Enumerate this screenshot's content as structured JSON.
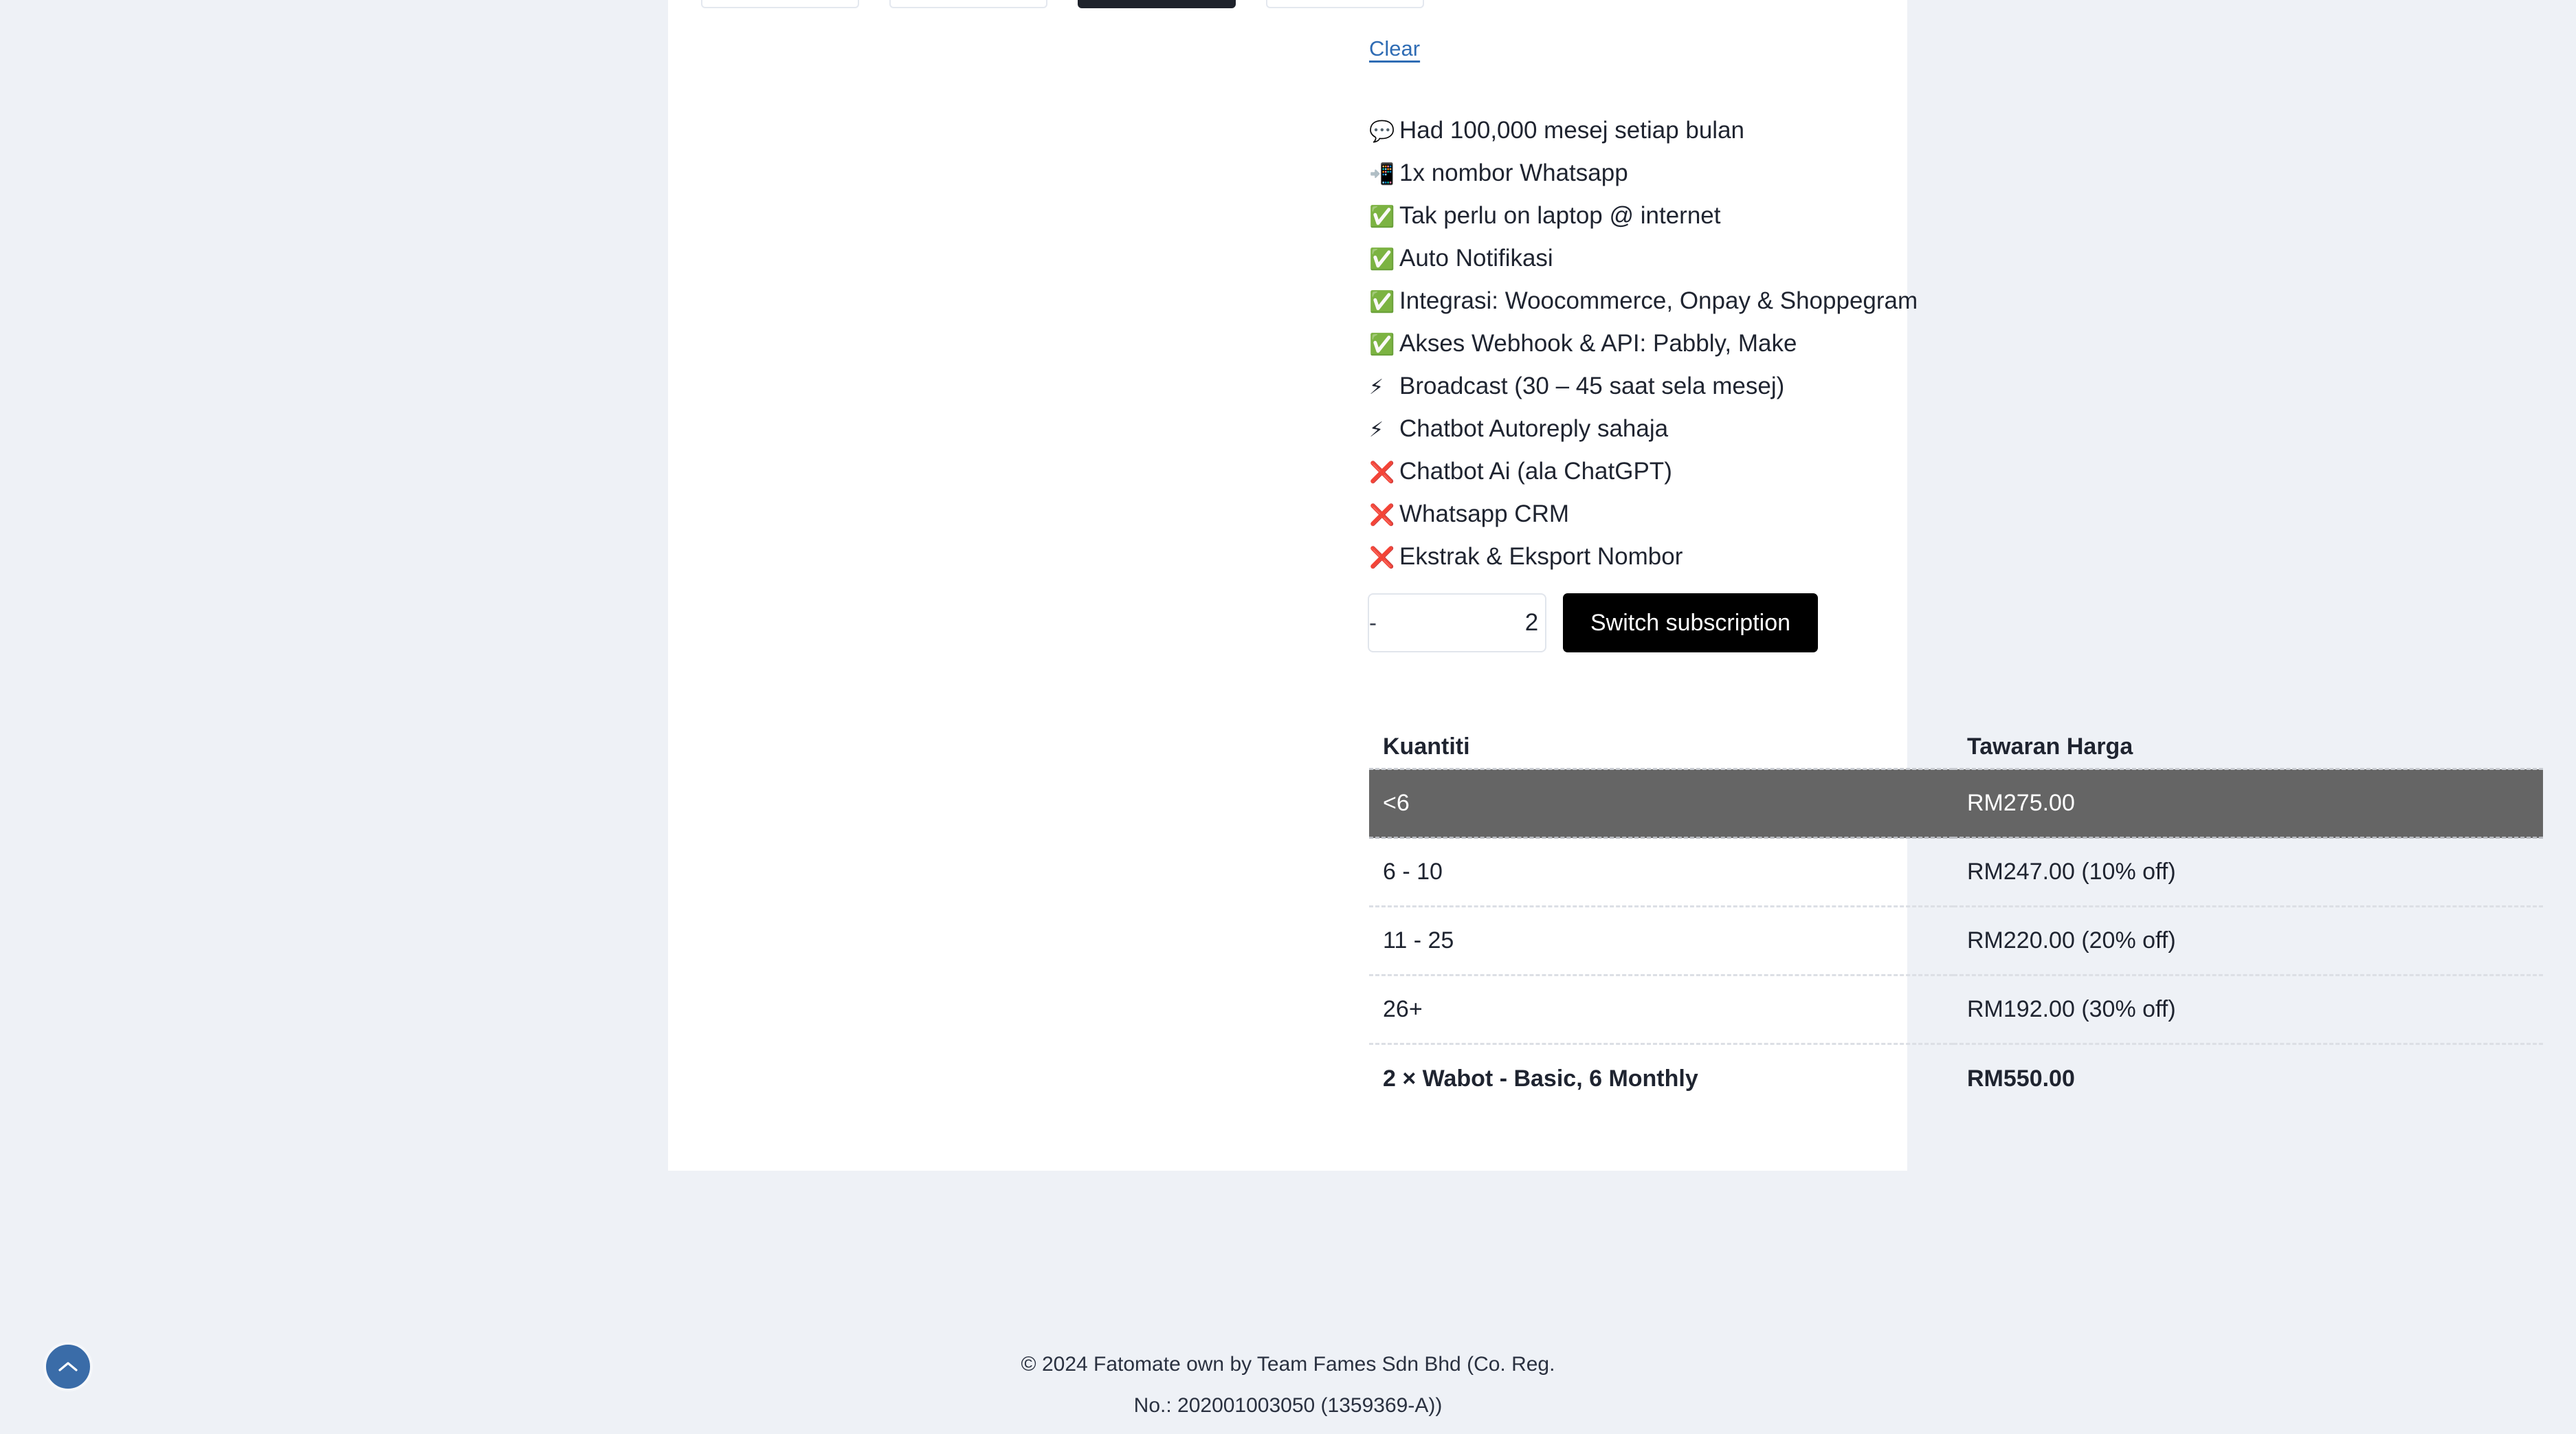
{
  "product": {
    "variations": [
      {
        "label": "",
        "selected": false
      },
      {
        "label": "",
        "selected": false
      },
      {
        "label": "",
        "selected": true
      },
      {
        "label": "",
        "selected": false
      }
    ],
    "clear_label": "Clear",
    "features": [
      {
        "icon": "💬",
        "icon_name": "speech-balloon-icon",
        "text": "Had 100,000 mesej setiap bulan"
      },
      {
        "icon": "📲",
        "icon_name": "mobile-phone-arrow-icon",
        "text": "1x nombor Whatsapp"
      },
      {
        "icon": "✅",
        "icon_name": "check-mark-button-icon",
        "text": "Tak perlu on laptop @ internet"
      },
      {
        "icon": "✅",
        "icon_name": "check-mark-button-icon",
        "text": "Auto Notifikasi"
      },
      {
        "icon": "✅",
        "icon_name": "check-mark-button-icon",
        "text": "Integrasi: Woocommerce, Onpay & Shoppegram"
      },
      {
        "icon": "✅",
        "icon_name": "check-mark-button-icon",
        "text": "Akses Webhook & API: Pabbly, Make"
      },
      {
        "icon": "⚡",
        "icon_name": "high-voltage-icon",
        "text": "Broadcast (30 – 45 saat sela mesej)"
      },
      {
        "icon": "⚡",
        "icon_name": "high-voltage-icon",
        "text": "Chatbot Autoreply sahaja"
      },
      {
        "icon": "❌",
        "icon_name": "cross-mark-icon",
        "text": "Chatbot Ai (ala ChatGPT)"
      },
      {
        "icon": "❌",
        "icon_name": "cross-mark-icon",
        "text": "Whatsapp CRM"
      },
      {
        "icon": "❌",
        "icon_name": "cross-mark-icon",
        "text": "Ekstrak & Eksport Nombor"
      }
    ],
    "quantity": {
      "decrement_label": "-",
      "value": "2",
      "increment_label": "+"
    },
    "switch_subscription_label": "Switch subscription"
  },
  "pricing_table": {
    "headers": [
      "Kuantiti",
      "Tawaran Harga"
    ],
    "rows": [
      {
        "quantity": "<6",
        "price": "RM275.00",
        "active": true
      },
      {
        "quantity": "6 - 10",
        "price": "RM247.00 (10% off)",
        "active": false
      },
      {
        "quantity": "11 - 25",
        "price": "RM220.00 (20% off)",
        "active": false
      },
      {
        "quantity": "26+",
        "price": "RM192.00 (30% off)",
        "active": false
      }
    ],
    "total_row": {
      "label": "2 × Wabot - Basic, 6 Monthly",
      "amount": "RM550.00"
    }
  },
  "footer": {
    "line1": "© 2024 Fatomate own by Team Fames Sdn Bhd (Co. Reg.",
    "line2": "No.: 202001003050 (1359369-A))"
  },
  "scroll_top": {
    "icon_name": "chevron-up-icon",
    "color": "#3a6ca8"
  },
  "colors": {
    "page_background": "#eef1f6",
    "card_background": "#ffffff",
    "link": "#2f6cb4",
    "active_row": "#656565",
    "primary_button": "#000000"
  }
}
